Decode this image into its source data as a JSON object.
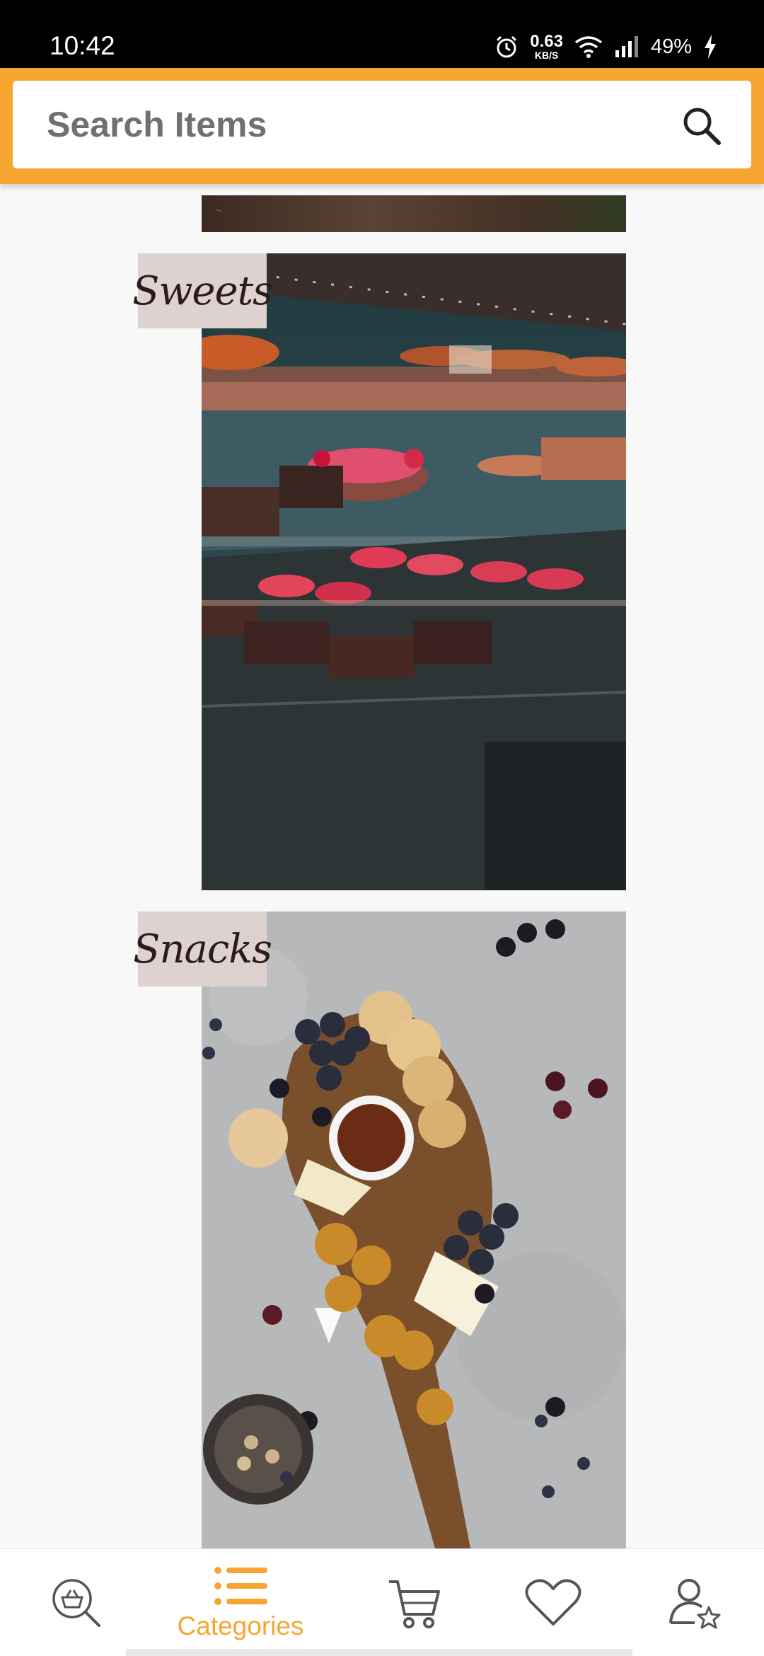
{
  "status_bar": {
    "time": "10:42",
    "net_speed_value": "0.63",
    "net_speed_unit": "KB/S",
    "battery": "49%",
    "icons": [
      "alarm-icon",
      "wifi-icon",
      "signal-icon",
      "charging-icon"
    ]
  },
  "search": {
    "placeholder": "Search Items",
    "icon": "search-icon"
  },
  "categories": [
    {
      "label": "Sweets",
      "image": "pastry-display-case-photo"
    },
    {
      "label": "Snacks",
      "image": "charcuterie-board-photo"
    }
  ],
  "bottom_nav": {
    "items": [
      {
        "name": "search-basket",
        "label": "",
        "icon": "basket-search-icon",
        "active": false
      },
      {
        "name": "categories",
        "label": "Categories",
        "icon": "list-icon",
        "active": true
      },
      {
        "name": "cart",
        "label": "",
        "icon": "cart-icon",
        "active": false
      },
      {
        "name": "favorites",
        "label": "",
        "icon": "heart-icon",
        "active": false
      },
      {
        "name": "profile",
        "label": "",
        "icon": "user-star-icon",
        "active": false
      }
    ]
  },
  "colors": {
    "accent": "#f7a531",
    "label_bg": "#ddd2cf",
    "label_text": "#2b1b1b"
  }
}
